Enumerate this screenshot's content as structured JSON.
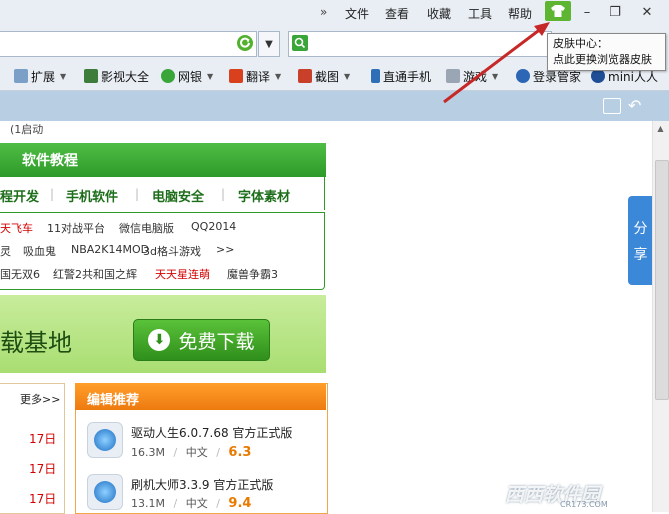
{
  "menu": {
    "chevron": "»",
    "items": [
      "文件",
      "查看",
      "收藏",
      "工具",
      "帮助"
    ]
  },
  "window": {
    "minimize": "–",
    "restore": "❐",
    "close": "✕"
  },
  "tooltip": {
    "line1": "皮肤中心：",
    "line2": "点此更换浏览器皮肤"
  },
  "address": {
    "value": "",
    "dropdown": "▼"
  },
  "search": {
    "value": ""
  },
  "bookmarks": [
    {
      "label": "扩展",
      "icon": "extension-icon",
      "caret": true
    },
    {
      "label": "影视大全",
      "icon": "video-icon",
      "caret": false
    },
    {
      "label": "网银",
      "icon": "bank-icon",
      "caret": true
    },
    {
      "label": "翻译",
      "icon": "translate-icon",
      "caret": true
    },
    {
      "label": "截图",
      "icon": "screenshot-icon",
      "caret": true
    },
    {
      "label": "直通手机",
      "icon": "phone-icon",
      "caret": false
    },
    {
      "label": "游戏",
      "icon": "game-icon",
      "caret": true
    },
    {
      "label": "登录管家",
      "icon": "key-icon",
      "caret": false
    },
    {
      "label": "mini人人",
      "icon": "renren-icon",
      "caret": false
    }
  ],
  "page": {
    "top_cut": "(1启动",
    "tutorial": {
      "title": "软件教程",
      "tabs": [
        "程开发",
        "手机软件",
        "电脑安全",
        "字体素材"
      ],
      "rows": [
        [
          {
            "t": "天飞车",
            "red": true
          },
          {
            "t": "11对战平台"
          },
          {
            "t": "微信电脑版"
          },
          {
            "t": "QQ2014"
          }
        ],
        [
          {
            "t": "灵"
          },
          {
            "t": "吸血鬼"
          },
          {
            "t": "NBA2K14MOD"
          },
          {
            "t": "3d格斗游戏"
          },
          {
            "t": ">>"
          }
        ],
        [
          {
            "t": "国无双6"
          },
          {
            "t": "红警2共和国之辉"
          },
          {
            "t": "天天星连萌",
            "red": true
          },
          {
            "t": "魔兽争霸3"
          }
        ]
      ]
    },
    "banner": {
      "text": "载基地",
      "button": "免费下载",
      "arrow": "⬇"
    },
    "left_box": {
      "more": "更多>>",
      "dates": [
        "17日",
        "17日",
        "17日"
      ]
    },
    "editor": {
      "title": "编辑推荐",
      "apps": [
        {
          "name": "驱动人生6.0.7.68 官方正式版",
          "size": "16.3M",
          "lang": "中文",
          "score": "6.3"
        },
        {
          "name": "刷机大师3.3.9 官方正式版",
          "size": "13.1M",
          "lang": "中文",
          "score": "9.4"
        }
      ],
      "sep": "/"
    },
    "share": [
      "分",
      "享"
    ]
  },
  "watermark": {
    "main": "西西软件园",
    "sub": "CR173.COM"
  },
  "colors": {
    "green": "#2e9a2a",
    "orange": "#ee7a10",
    "blue": "#3b87d8",
    "annotation": "#c62828"
  }
}
